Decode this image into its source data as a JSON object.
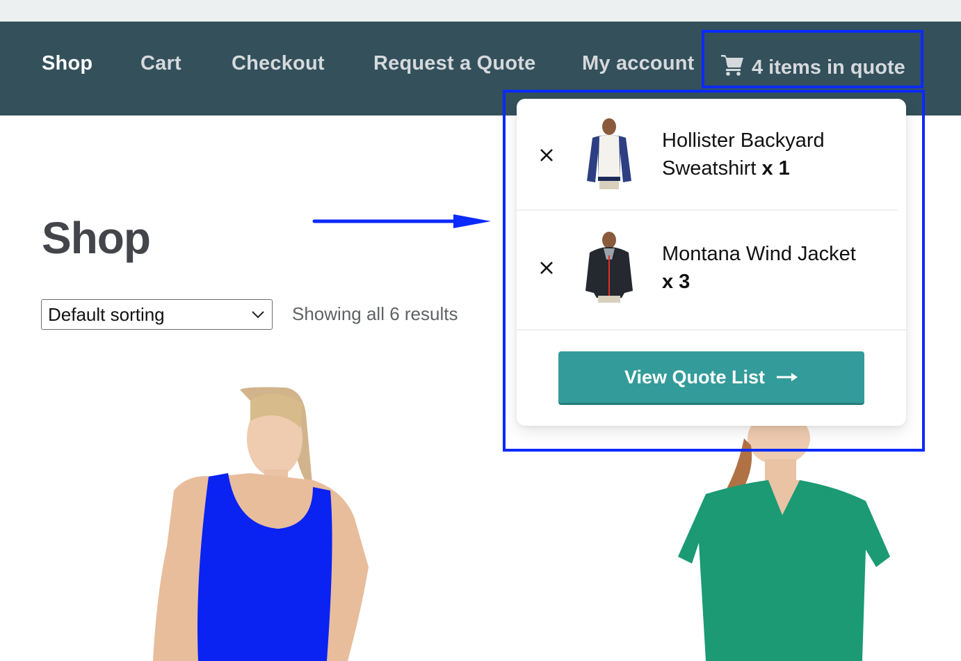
{
  "nav": {
    "items": [
      {
        "label": "Shop",
        "active": true
      },
      {
        "label": "Cart",
        "active": false
      },
      {
        "label": "Checkout",
        "active": false
      },
      {
        "label": "Request a Quote",
        "active": false
      },
      {
        "label": "My account",
        "active": false
      }
    ],
    "quote_toggle": {
      "icon": "cart-icon",
      "label": "4 items in quote"
    }
  },
  "page": {
    "title": "Shop",
    "sorting": {
      "selected": "Default sorting"
    },
    "result_count": "Showing all 6 results"
  },
  "quote_panel": {
    "items": [
      {
        "name": "Hollister Backyard Sweatshirt",
        "qty_label": "x 1",
        "remove_icon": "close-icon"
      },
      {
        "name": "Montana Wind Jacket",
        "qty_label": "x 3",
        "remove_icon": "close-icon"
      }
    ],
    "view_button": {
      "label": "View Quote List",
      "icon": "arrow-right-icon"
    }
  },
  "colors": {
    "navbar": "#33505b",
    "button": "#339b9a",
    "annotation": "#0a2aff"
  }
}
